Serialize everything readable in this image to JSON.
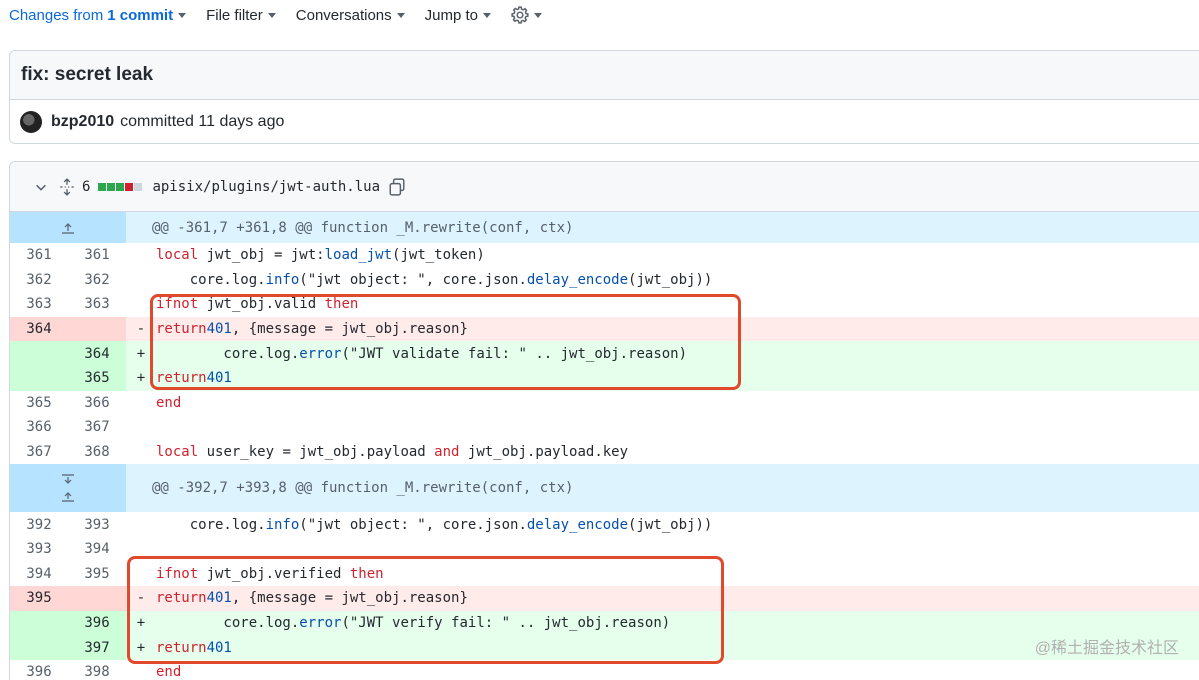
{
  "toolbar": {
    "changes_from": "Changes from",
    "commit_count": "1 commit",
    "file_filter": "File filter",
    "conversations": "Conversations",
    "jump_to": "Jump to"
  },
  "commit": {
    "title": "fix: secret leak",
    "author": "bzp2010",
    "meta": "committed 11 days ago",
    "truncated": "c"
  },
  "file": {
    "change_count": "6",
    "name": "apisix/plugins/jwt-auth.lua"
  },
  "diff": {
    "hunk1": "@@ -361,7 +361,8 @@ function _M.rewrite(conf, ctx)",
    "hunk2": "@@ -392,7 +393,8 @@ function _M.rewrite(conf, ctx)",
    "lines": [
      {
        "old": "361",
        "new": "361",
        "sign": "",
        "type": "ctx",
        "code": "    local jwt_obj = jwt:load_jwt(jwt_token)"
      },
      {
        "old": "362",
        "new": "362",
        "sign": "",
        "type": "ctx",
        "code": "    core.log.info(\"jwt object: \", core.json.delay_encode(jwt_obj))"
      },
      {
        "old": "363",
        "new": "363",
        "sign": "",
        "type": "ctx",
        "code": "    if not jwt_obj.valid then"
      },
      {
        "old": "364",
        "new": "",
        "sign": "-",
        "type": "del",
        "code": "        return 401, {message = jwt_obj.reason}"
      },
      {
        "old": "",
        "new": "364",
        "sign": "+",
        "type": "add",
        "code": "        core.log.error(\"JWT validate fail: \" .. jwt_obj.reason)"
      },
      {
        "old": "",
        "new": "365",
        "sign": "+",
        "type": "add",
        "code": "        return 401"
      },
      {
        "old": "365",
        "new": "366",
        "sign": "",
        "type": "ctx",
        "code": "    end"
      },
      {
        "old": "366",
        "new": "367",
        "sign": "",
        "type": "ctx",
        "code": ""
      },
      {
        "old": "367",
        "new": "368",
        "sign": "",
        "type": "ctx",
        "code": "    local user_key = jwt_obj.payload and jwt_obj.payload.key"
      },
      {
        "old": "392",
        "new": "393",
        "sign": "",
        "type": "ctx",
        "code": "    core.log.info(\"jwt object: \", core.json.delay_encode(jwt_obj))"
      },
      {
        "old": "393",
        "new": "394",
        "sign": "",
        "type": "ctx",
        "code": ""
      },
      {
        "old": "394",
        "new": "395",
        "sign": "",
        "type": "ctx",
        "code": "    if not jwt_obj.verified then"
      },
      {
        "old": "395",
        "new": "",
        "sign": "-",
        "type": "del",
        "code": "        return 401, {message = jwt_obj.reason}"
      },
      {
        "old": "",
        "new": "396",
        "sign": "+",
        "type": "add",
        "code": "        core.log.error(\"JWT verify fail: \" .. jwt_obj.reason)"
      },
      {
        "old": "",
        "new": "397",
        "sign": "+",
        "type": "add",
        "code": "        return 401"
      },
      {
        "old": "396",
        "new": "398",
        "sign": "",
        "type": "ctx",
        "code": "    end"
      }
    ]
  },
  "watermark": "@稀土掘金技术社区",
  "colors": {
    "accent": "#0969da",
    "highlight_border": "#e0492c",
    "add_bg": "#e6ffec",
    "del_bg": "#ffebe9",
    "hunk_bg": "#ddf4ff"
  }
}
